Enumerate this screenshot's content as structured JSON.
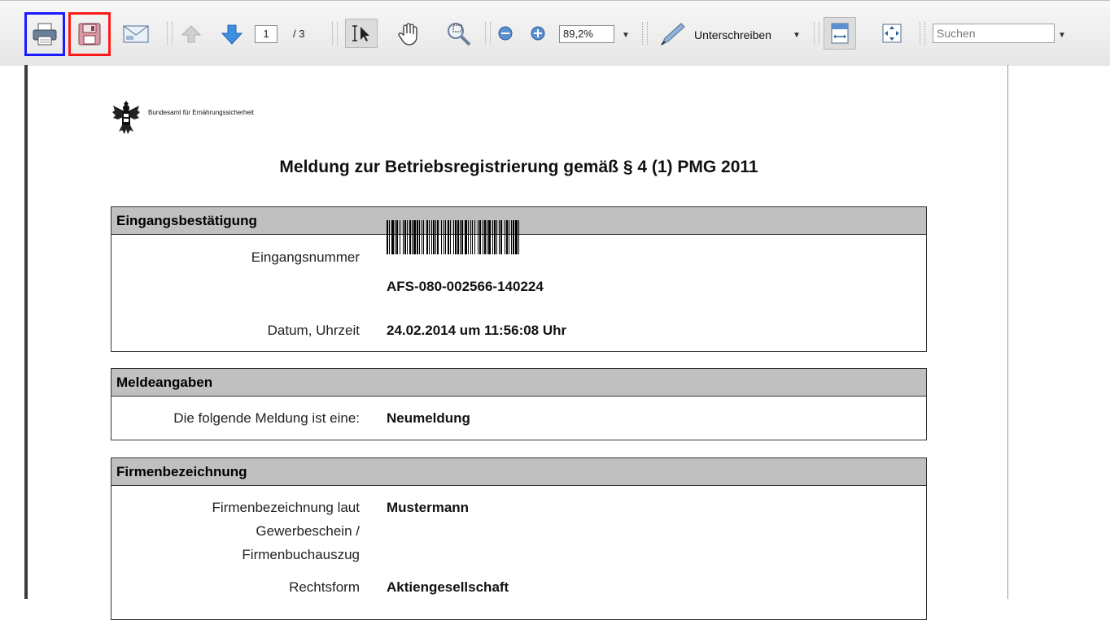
{
  "toolbar": {
    "print_icon": "print-icon",
    "save_icon": "save-icon",
    "email_icon": "email-icon",
    "prev_page_icon": "arrow-up-icon",
    "next_page_icon": "arrow-down-icon",
    "page_current": "1",
    "page_total": "/ 3",
    "select_tool_icon": "text-select-icon",
    "hand_tool_icon": "hand-icon",
    "marquee_zoom_icon": "zoom-marquee-icon",
    "zoom_out_icon": "zoom-out-icon",
    "zoom_in_icon": "zoom-in-icon",
    "zoom_value": "89,2%",
    "sign_label": "Unterschreiben",
    "fit_width_icon": "fit-width-icon",
    "fit_page_icon": "fit-page-icon",
    "search_placeholder": "Suchen",
    "highlight_colors": {
      "print": "#1a1aff",
      "save": "#ff1a1a"
    }
  },
  "document": {
    "agency": "Bundesamt für Ernährungssicherheit",
    "title": "Meldung zur Betriebsregistrierung gemäß § 4 (1) PMG 2011",
    "sections": {
      "eingang": {
        "header": "Eingangsbestätigung",
        "number_label": "Eingangsnummer",
        "number_value": "AFS-080-002566-140224",
        "date_label": "Datum, Uhrzeit",
        "date_value": "24.02.2014 um 11:56:08 Uhr"
      },
      "melde": {
        "header": "Meldeangaben",
        "type_label": "Die folgende Meldung ist eine:",
        "type_value": "Neumeldung"
      },
      "firma": {
        "header": "Firmenbezeichnung",
        "name_label_1": "Firmenbezeichnung laut",
        "name_label_2": "Gewerbeschein /",
        "name_label_3": "Firmenbuchauszug",
        "name_value": "Mustermann",
        "form_label": "Rechtsform",
        "form_value": "Aktiengesellschaft"
      }
    }
  }
}
